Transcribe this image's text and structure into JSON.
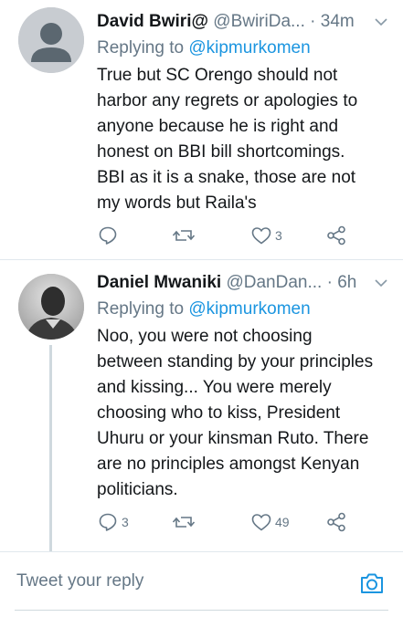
{
  "tweets": [
    {
      "name": "David Bwiri@",
      "handle": "@BwiriDa...",
      "time": "· 34m",
      "avatar": "default-avatar-icon",
      "replying_label": "Replying to",
      "replying_to": "@kipmurkomen",
      "text_lines": [
        "True but SC Orengo should not",
        "harbor any regrets or apologies to",
        "anyone because he is right and",
        "honest on BBI bill shortcomings.",
        "BBI as it is a snake, those are not",
        "my words but Raila's"
      ],
      "reply_count": "",
      "retweet_count": "",
      "like_count": "3"
    },
    {
      "name": "Daniel Mwaniki",
      "handle": "@DanDan...",
      "time": "· 6h",
      "avatar": "profile-photo",
      "replying_label": "Replying to",
      "replying_to": "@kipmurkomen",
      "text_lines": [
        "Noo, you were not choosing",
        "between standing by your principles",
        "and kissing... You were merely",
        "choosing who to kiss, President",
        "Uhuru or your kinsman Ruto. There",
        "are no principles amongst Kenyan",
        "politicians."
      ],
      "reply_count": "3",
      "retweet_count": "",
      "like_count": "49"
    }
  ],
  "reply_bar": {
    "placeholder": "Tweet your reply",
    "icon": "camera-icon"
  },
  "colors": {
    "text": "#14171a",
    "secondary": "#657786",
    "link": "#1b95e0",
    "divider": "#e1e8ed"
  }
}
